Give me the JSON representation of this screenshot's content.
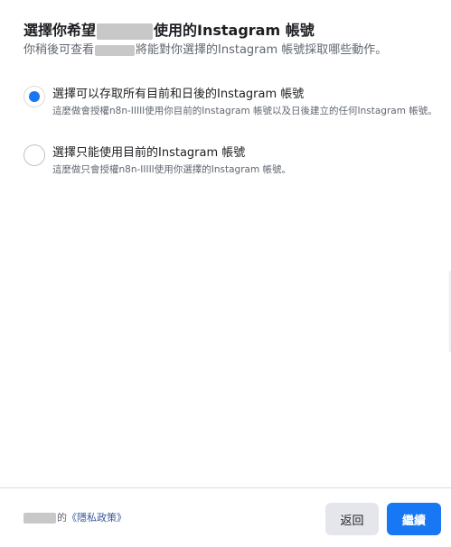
{
  "header": {
    "title_prefix": "選擇你希望",
    "title_suffix": "使用的Instagram 帳號",
    "subtitle_prefix": "你稍後可查看",
    "subtitle_suffix": "將能對你選擇的Instagram 帳號採取哪些動作。"
  },
  "options": [
    {
      "label": "選擇可以存取所有目前和日後的Instagram 帳號",
      "description": "這麼做會授權n8n-IIIII使用你目前的Instagram 帳號以及日後建立的任何Instagram 帳號。",
      "selected": true
    },
    {
      "label": "選擇只能使用目前的Instagram 帳號",
      "description": "這麼做只會授權n8n-IIIII使用你選擇的Instagram 帳號。",
      "selected": false
    }
  ],
  "footer": {
    "text_suffix": "的",
    "privacy_link": "《隱私政策》",
    "back_label": "返回",
    "continue_label": "繼續"
  },
  "colors": {
    "accent": "#1877f2",
    "link": "#385898",
    "secondary_button": "#e4e6eb"
  }
}
